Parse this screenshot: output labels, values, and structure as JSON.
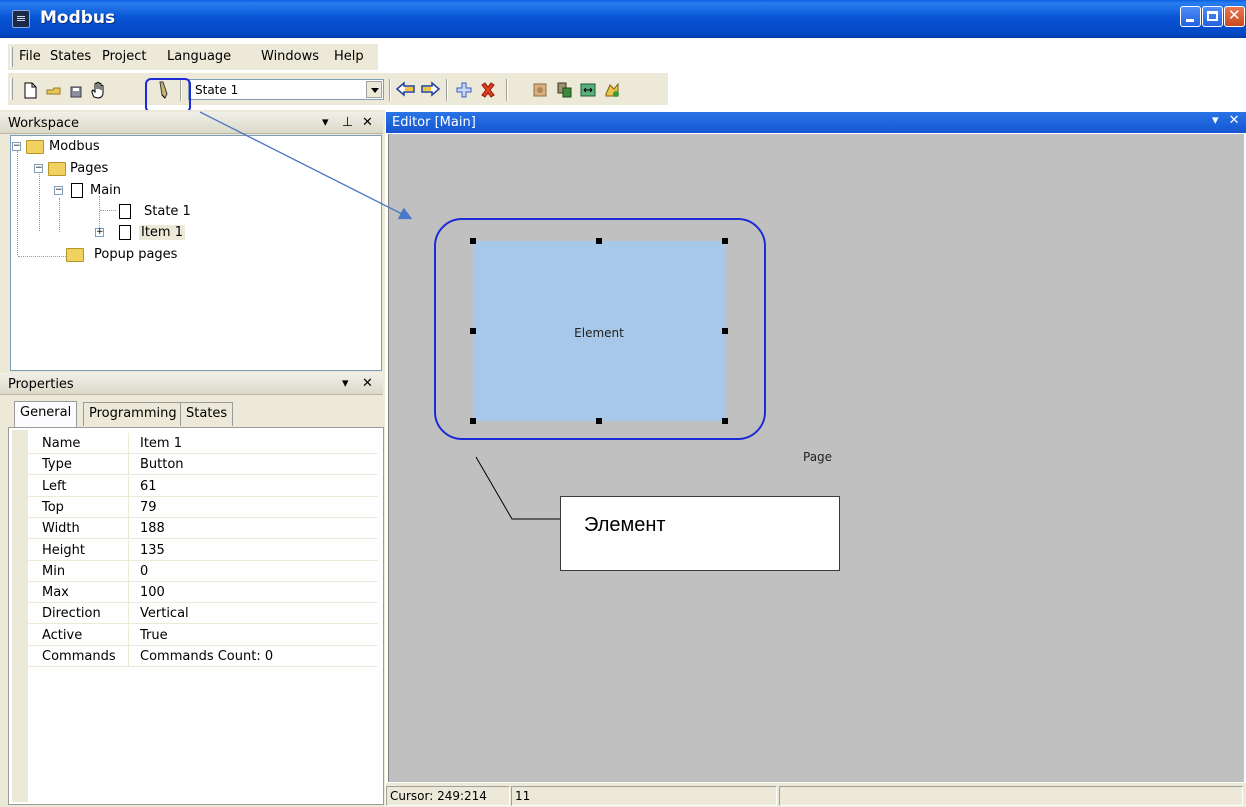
{
  "window": {
    "title": "Modbus"
  },
  "menu": [
    "File",
    "States",
    "Project",
    "Language",
    "Windows",
    "Help"
  ],
  "toolbar": {
    "state_select_value": "State 1"
  },
  "workspace": {
    "title": "Workspace",
    "tree": [
      {
        "label": "Modbus"
      },
      {
        "label": "Pages"
      },
      {
        "label": "Main"
      },
      {
        "label": "State 1"
      },
      {
        "label": "Item 1"
      },
      {
        "label": "Popup pages"
      }
    ]
  },
  "properties": {
    "title": "Properties",
    "tabs": [
      "General",
      "Programming",
      "States"
    ],
    "rows": [
      {
        "name": "Name",
        "value": "Item 1"
      },
      {
        "name": "Type",
        "value": "Button"
      },
      {
        "name": "Left",
        "value": "61"
      },
      {
        "name": "Top",
        "value": "79"
      },
      {
        "name": "Width",
        "value": "188"
      },
      {
        "name": "Height",
        "value": "135"
      },
      {
        "name": "Min",
        "value": "0"
      },
      {
        "name": "Max",
        "value": "100"
      },
      {
        "name": "Direction",
        "value": "Vertical"
      },
      {
        "name": "Active",
        "value": "True"
      },
      {
        "name": "Commands",
        "value": "Commands Count: 0"
      }
    ]
  },
  "editor": {
    "title": "Editor [Main]",
    "element_label": "Element",
    "page_label": "Page",
    "callout_label": "Элемент"
  },
  "status": {
    "cursor": "Cursor: 249:214",
    "value": "11"
  },
  "colors": {
    "accent_highlight": "#1d2bd6",
    "element_fill": "#a8c8ea",
    "canvas": "#c0c0c0",
    "titlebar": "#0855d6"
  }
}
